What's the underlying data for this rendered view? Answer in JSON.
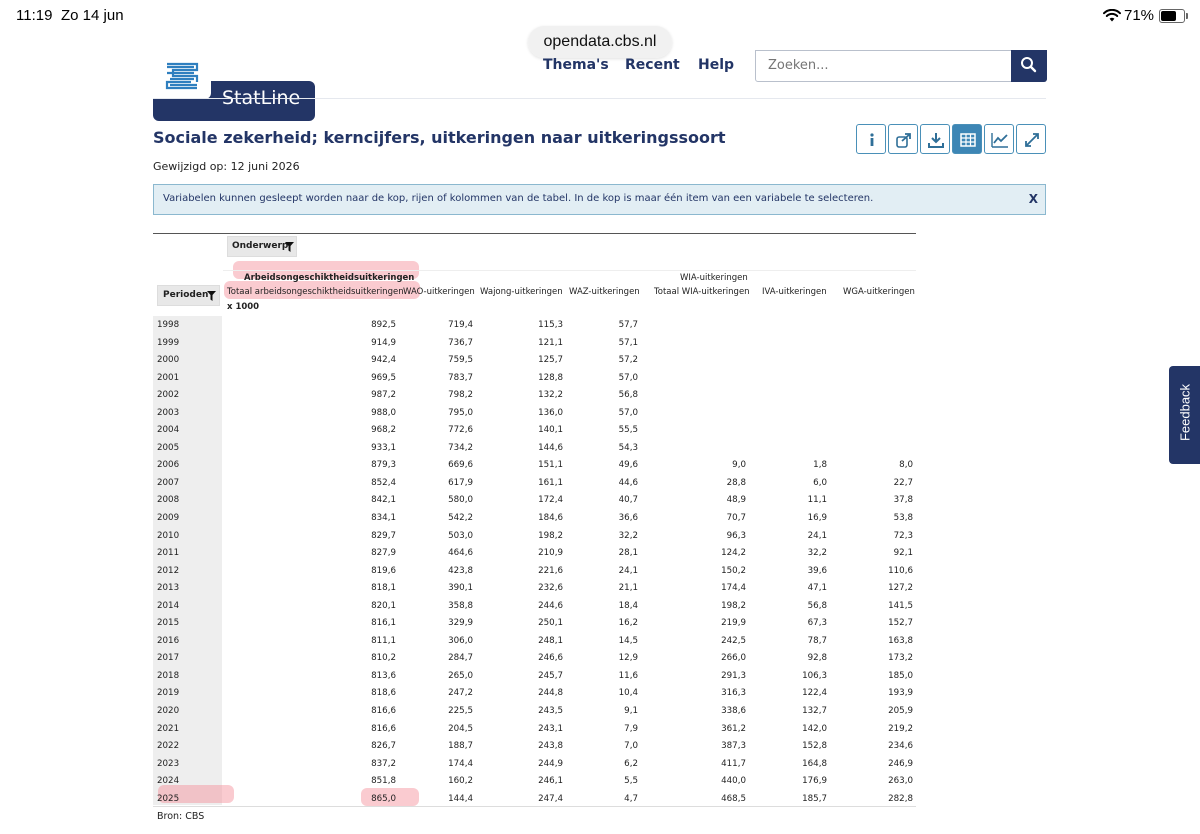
{
  "status_bar": {
    "time": "11:19",
    "date": "Zo 14 jun",
    "battery": "71%"
  },
  "browser": {
    "url": "opendata.cbs.nl"
  },
  "header": {
    "brand": "StatLine",
    "nav": [
      "Thema's",
      "Recent",
      "Help"
    ],
    "search_placeholder": "Zoeken..."
  },
  "page": {
    "title": "Sociale zekerheid; kerncijfers, uitkeringen naar uitkeringssoort",
    "modified": "Gewijzigd op: 12 juni 2026",
    "banner": "Variabelen kunnen gesleept worden naar de kop, rijen of kolommen van de tabel. In de kop is maar één item van een variabele te selecteren.",
    "banner_close": "X",
    "source": "Bron: CBS",
    "feedback": "Feedback"
  },
  "toolbar": [
    "info-icon",
    "share-icon",
    "download-icon",
    "table-icon",
    "chart-icon",
    "expand-icon"
  ],
  "table": {
    "onderwerp_label": "Onderwerp",
    "perioden_label": "Perioden",
    "group_ao": "Arbeidsongeschiktheidsuitkeringen",
    "group_wia": "WIA-uitkeringen",
    "columns": [
      "Totaal arbeidsongeschiktheidsuitkeringen",
      "WAO-uitkeringen",
      "Wajong-uitkeringen",
      "WAZ-uitkeringen",
      "Totaal WIA-uitkeringen",
      "IVA-uitkeringen",
      "WGA-uitkeringen"
    ],
    "unit": "x 1000",
    "rows": [
      [
        "1998",
        "892,5",
        "719,4",
        "115,3",
        "57,7",
        "",
        "",
        ""
      ],
      [
        "1999",
        "914,9",
        "736,7",
        "121,1",
        "57,1",
        "",
        "",
        ""
      ],
      [
        "2000",
        "942,4",
        "759,5",
        "125,7",
        "57,2",
        "",
        "",
        ""
      ],
      [
        "2001",
        "969,5",
        "783,7",
        "128,8",
        "57,0",
        "",
        "",
        ""
      ],
      [
        "2002",
        "987,2",
        "798,2",
        "132,2",
        "56,8",
        "",
        "",
        ""
      ],
      [
        "2003",
        "988,0",
        "795,0",
        "136,0",
        "57,0",
        "",
        "",
        ""
      ],
      [
        "2004",
        "968,2",
        "772,6",
        "140,1",
        "55,5",
        "",
        "",
        ""
      ],
      [
        "2005",
        "933,1",
        "734,2",
        "144,6",
        "54,3",
        "",
        "",
        ""
      ],
      [
        "2006",
        "879,3",
        "669,6",
        "151,1",
        "49,6",
        "9,0",
        "1,8",
        "8,0"
      ],
      [
        "2007",
        "852,4",
        "617,9",
        "161,1",
        "44,6",
        "28,8",
        "6,0",
        "22,7"
      ],
      [
        "2008",
        "842,1",
        "580,0",
        "172,4",
        "40,7",
        "48,9",
        "11,1",
        "37,8"
      ],
      [
        "2009",
        "834,1",
        "542,2",
        "184,6",
        "36,6",
        "70,7",
        "16,9",
        "53,8"
      ],
      [
        "2010",
        "829,7",
        "503,0",
        "198,2",
        "32,2",
        "96,3",
        "24,1",
        "72,3"
      ],
      [
        "2011",
        "827,9",
        "464,6",
        "210,9",
        "28,1",
        "124,2",
        "32,2",
        "92,1"
      ],
      [
        "2012",
        "819,6",
        "423,8",
        "221,6",
        "24,1",
        "150,2",
        "39,6",
        "110,6"
      ],
      [
        "2013",
        "818,1",
        "390,1",
        "232,6",
        "21,1",
        "174,4",
        "47,1",
        "127,2"
      ],
      [
        "2014",
        "820,1",
        "358,8",
        "244,6",
        "18,4",
        "198,2",
        "56,8",
        "141,5"
      ],
      [
        "2015",
        "816,1",
        "329,9",
        "250,1",
        "16,2",
        "219,9",
        "67,3",
        "152,7"
      ],
      [
        "2016",
        "811,1",
        "306,0",
        "248,1",
        "14,5",
        "242,5",
        "78,7",
        "163,8"
      ],
      [
        "2017",
        "810,2",
        "284,7",
        "246,6",
        "12,9",
        "266,0",
        "92,8",
        "173,2"
      ],
      [
        "2018",
        "813,6",
        "265,0",
        "245,7",
        "11,6",
        "291,3",
        "106,3",
        "185,0"
      ],
      [
        "2019",
        "818,6",
        "247,2",
        "244,8",
        "10,4",
        "316,3",
        "122,4",
        "193,9"
      ],
      [
        "2020",
        "816,6",
        "225,5",
        "243,5",
        "9,1",
        "338,6",
        "132,7",
        "205,9"
      ],
      [
        "2021",
        "816,6",
        "204,5",
        "243,1",
        "7,9",
        "361,2",
        "142,0",
        "219,2"
      ],
      [
        "2022",
        "826,7",
        "188,7",
        "243,8",
        "7,0",
        "387,3",
        "152,8",
        "234,6"
      ],
      [
        "2023",
        "837,2",
        "174,4",
        "244,9",
        "6,2",
        "411,7",
        "164,8",
        "246,9"
      ],
      [
        "2024",
        "851,8",
        "160,2",
        "246,1",
        "5,5",
        "440,0",
        "176,9",
        "263,0"
      ],
      [
        "2025",
        "865,0",
        "144,4",
        "247,4",
        "4,7",
        "468,5",
        "185,7",
        "282,8"
      ]
    ]
  }
}
